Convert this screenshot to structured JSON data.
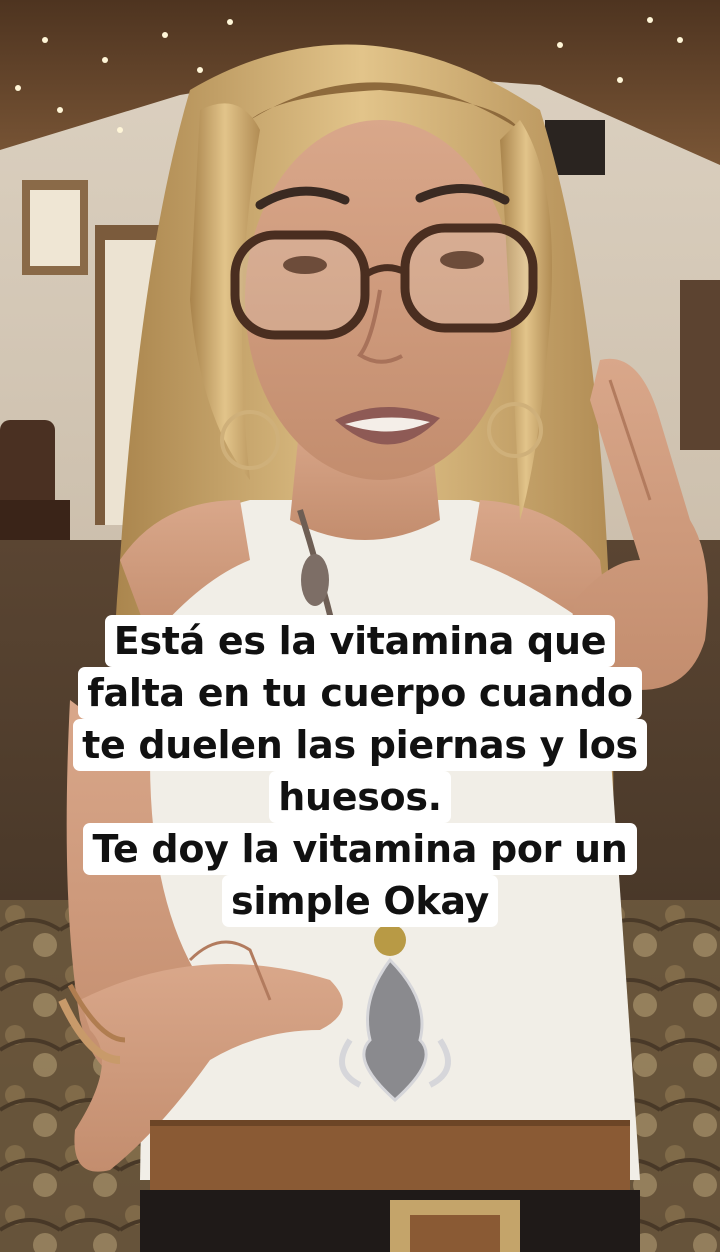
{
  "caption": {
    "lines": [
      "Está es la vitamina que",
      "falta en tu cuerpo cuando",
      "te duelen las piernas y los",
      "huesos.",
      "Te doy la vitamina por un",
      "simple Okay"
    ]
  },
  "colors": {
    "caption_background": "#ffffff",
    "caption_text": "#111111",
    "ceiling": "#6b4a2e",
    "wall": "#d8ccbb",
    "hair": "#d9b878",
    "top": "#f2efe8",
    "belt": "#8a5a34"
  },
  "icons": {
    "background_image": "photo-of-woman-speaking"
  }
}
